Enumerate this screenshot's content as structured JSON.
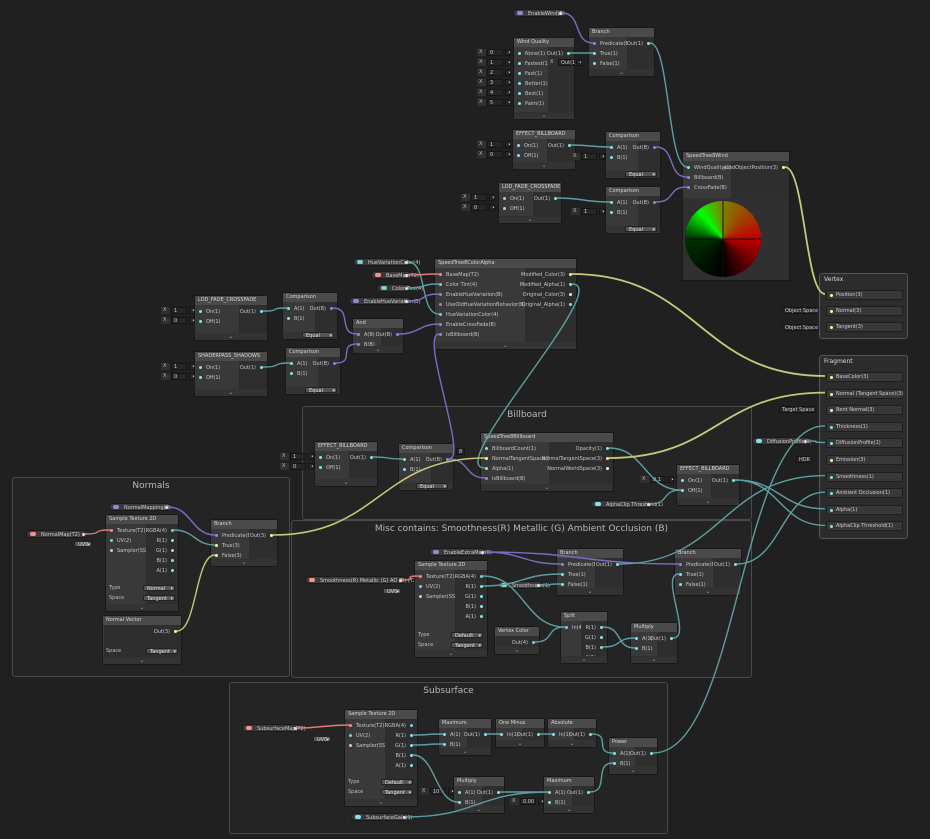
{
  "groups": {
    "billboard": "Billboard",
    "normals": "Normals",
    "misc": "Misc contains:  Smoothness(R) Metallic (G) Ambient Occlusion (B)",
    "subsurface": "Subsurface"
  },
  "nodes": {
    "branch_top": {
      "title": "Branch",
      "inputs": [
        "Predicate(B)",
        "True(1)",
        "False(1)"
      ],
      "outputs": [
        "Out(1)"
      ]
    },
    "wind_quality": {
      "title": "Wind Quality",
      "inputs": [
        "None(1)",
        "Fastest(1)",
        "Fast(1)",
        "Better(1)",
        "Best(1)",
        "Palm(1)"
      ],
      "outputs": [
        "Out(1)"
      ],
      "values": [
        "0",
        "1",
        "2",
        "3",
        "4",
        "5"
      ]
    },
    "effect_billboard_1": {
      "title": "EFFECT_BILLBOARD",
      "inputs": [
        "On(1)",
        "Off(1)"
      ],
      "outputs": [
        "Out(1)"
      ],
      "values": [
        "1",
        "0"
      ]
    },
    "comparison_1": {
      "title": "Comparison",
      "inputs": [
        "A(1)",
        "B(1)"
      ],
      "outputs": [
        "Out(B)"
      ],
      "select": "Equal",
      "b_value": "1"
    },
    "lod_fade_1": {
      "title": "LOD_FADE_CROSSFADE",
      "inputs": [
        "On(1)",
        "Off(1)"
      ],
      "outputs": [
        "Out(1)"
      ],
      "values": [
        "1",
        "0"
      ]
    },
    "comparison_2": {
      "title": "Comparison",
      "inputs": [
        "A(1)",
        "B(1)"
      ],
      "outputs": [
        "Out(B)"
      ],
      "select": "Equal",
      "b_value": "1"
    },
    "speedtree_wind": {
      "title": "SpeedTree8Wind",
      "inputs": [
        "WindQuality(1)",
        "Billboard(B)",
        "CrossFade(B)"
      ],
      "outputs": [
        "windObjectPosition(3)"
      ]
    },
    "color_alpha": {
      "title": "SpeedTree8ColorAlpha",
      "inputs": [
        "BaseMap(T2)",
        "Color Tint(4)",
        "EnableHueVariation(B)",
        "UseOldHueVariationBehavior(B)",
        "HueVariationColor(4)",
        "EnableCrossFade(B)",
        "IsBillboard(B)"
      ],
      "outputs": [
        "Modified_Color(3)",
        "Modified_Alpha(1)",
        "Original_Color(3)",
        "Original_Alpha(1)"
      ]
    },
    "lod_fade_2": {
      "title": "LOD_FADE_CROSSFADE",
      "inputs": [
        "On(1)",
        "Off(1)"
      ],
      "outputs": [
        "Out(1)"
      ],
      "values": [
        "1",
        "0"
      ]
    },
    "comparison_3": {
      "title": "Comparison",
      "inputs": [
        "A(1)",
        "B(1)"
      ],
      "outputs": [
        "Out(B)"
      ],
      "select": "Equal",
      "b_value": "1"
    },
    "shaderpass": {
      "title": "SHADERPASS_SHADOWS",
      "inputs": [
        "On(1)",
        "Off(1)"
      ],
      "outputs": [
        "Out(1)"
      ],
      "values": [
        "1",
        "0"
      ]
    },
    "comparison_4": {
      "title": "Comparison",
      "inputs": [
        "A(1)",
        "B(1)"
      ],
      "outputs": [
        "Out(B)"
      ],
      "select": "Equal",
      "b_value": "1"
    },
    "and": {
      "title": "And",
      "inputs": [
        "A(B)",
        "B(B)"
      ],
      "outputs": [
        "Out(B)"
      ]
    },
    "effect_billboard_2": {
      "title": "EFFECT_BILLBOARD",
      "inputs": [
        "On(1)",
        "Off(1)"
      ],
      "outputs": [
        "Out(1)"
      ],
      "values": [
        "1",
        "0"
      ]
    },
    "comparison_5": {
      "title": "Comparison",
      "inputs": [
        "A(1)",
        "B(1)"
      ],
      "outputs": [
        "Out(B)"
      ],
      "select": "Equal",
      "b_value": "1"
    },
    "speedtree_billboard": {
      "title": "SpeedTree8Billboard",
      "inputs": [
        "BillboardCount(1)",
        "NormalTangentSpace(3)",
        "Alpha(1)",
        "IsBillboard(B)"
      ],
      "outputs": [
        "Opacity(1)",
        "NormalTangentSpace(3)",
        "NormalWorldSpace(3)"
      ],
      "count_value": "8"
    },
    "effect_billboard_3": {
      "title": "EFFECT_BILLBOARD",
      "inputs": [
        "On(1)",
        "Off(1)"
      ],
      "outputs": [
        "Out(1)"
      ],
      "on_value": "0.1"
    },
    "sample_normal": {
      "title": "Sample Texture 2D",
      "inputs": [
        "Texture(T2)",
        "UV(2)",
        "Sampler(SS)"
      ],
      "outputs": [
        "RGBA(4)",
        "R(1)",
        "G(1)",
        "B(1)",
        "A(1)"
      ],
      "type_label": "Type",
      "type_value": "Normal",
      "space_label": "Space",
      "space_value": "Tangent",
      "uv_value": "UV0"
    },
    "branch_normal": {
      "title": "Branch",
      "inputs": [
        "Predicate(B)",
        "True(3)",
        "False(3)"
      ],
      "outputs": [
        "Out(3)"
      ]
    },
    "normal_vector": {
      "title": "Normal Vector",
      "outputs": [
        "Out(3)"
      ],
      "space_label": "Space",
      "space_value": "Tangent"
    },
    "sample_misc": {
      "title": "Sample Texture 2D",
      "inputs": [
        "Texture(T2)",
        "UV(2)",
        "Sampler(SS)"
      ],
      "outputs": [
        "RGBA(4)",
        "R(1)",
        "G(1)",
        "B(1)",
        "A(1)"
      ],
      "type_label": "Type",
      "type_value": "Default",
      "space_label": "Space",
      "space_value": "Tangent",
      "uv_value": "UV0"
    },
    "branch_misc_1": {
      "title": "Branch",
      "inputs": [
        "Predicate(B)",
        "True(1)",
        "False(1)"
      ],
      "outputs": [
        "Out(1)"
      ]
    },
    "branch_misc_2": {
      "title": "Branch",
      "inputs": [
        "Predicate(B)",
        "True(1)",
        "False(1)"
      ],
      "outputs": [
        "Out(1)"
      ]
    },
    "split": {
      "title": "Split",
      "inputs": [
        "In(4)"
      ],
      "outputs": [
        "R(1)",
        "G(1)",
        "B(1)",
        "A(1)"
      ]
    },
    "vertex_color": {
      "title": "Vertex Color",
      "outputs": [
        "Out(4)"
      ]
    },
    "multiply_1": {
      "title": "Multiply",
      "inputs": [
        "A(1)",
        "B(1)"
      ],
      "outputs": [
        "Out(1)"
      ]
    },
    "sample_sub": {
      "title": "Sample Texture 2D",
      "inputs": [
        "Texture(T2)",
        "UV(2)",
        "Sampler(SS)"
      ],
      "outputs": [
        "RGBA(4)",
        "R(1)",
        "G(1)",
        "B(1)",
        "A(1)"
      ],
      "type_label": "Type",
      "type_value": "Default",
      "space_label": "Space",
      "space_value": "Tangent",
      "uv_value": "UV0"
    },
    "maximum_1": {
      "title": "Maximum",
      "inputs": [
        "A(1)",
        "B(1)"
      ],
      "outputs": [
        "Out(1)"
      ]
    },
    "one_minus": {
      "title": "One Minus",
      "inputs": [
        "In(1)"
      ],
      "outputs": [
        "Out(1)"
      ]
    },
    "absolute": {
      "title": "Absolute",
      "inputs": [
        "In(1)"
      ],
      "outputs": [
        "Out(1)"
      ]
    },
    "power": {
      "title": "Power",
      "inputs": [
        "A(1)",
        "B(1)"
      ],
      "outputs": [
        "Out(1)"
      ]
    },
    "multiply_2": {
      "title": "Multiply",
      "inputs": [
        "A(1)",
        "B(1)"
      ],
      "outputs": [
        "Out(1)"
      ],
      "a_value": "10"
    },
    "maximum_2": {
      "title": "Maximum",
      "inputs": [
        "A(1)",
        "B(1)"
      ],
      "outputs": [
        "Out(1)"
      ],
      "b_value": "0.00"
    }
  },
  "properties": {
    "enable_wind": "EnableWind(B)",
    "hue_color": "HueVariationColor(4)",
    "base_map": "BaseMap(T2)",
    "color_tint": "Color Tint(4)",
    "enable_hue": "EnableHueVariation(B)",
    "normal_map_b": "NormalMapping(B)",
    "normal_map_t": "NormalMap(T2)",
    "enable_extras": "EnableExtraMap(B)",
    "misc_map": "Smoothness(R) Metallic (G) AO (B) (T2)",
    "smoothness": "Smoothness(1)",
    "subsurface_map": "SubsurfaceMap(T2)",
    "subsurface_gain": "SubsurfaceGain(1)",
    "alpha_clip": "AlphaClip Threshold(1)",
    "diffusion_profile": "DiffusionProfile(1)"
  },
  "master": {
    "vertex_title": "Vertex",
    "vertex_slots": [
      "Position(3)",
      "Normal(3)",
      "Tangent(3)"
    ],
    "fragment_title": "Fragment",
    "fragment_slots": [
      "BaseColor(3)",
      "Normal (Tangent Space)(3)",
      "Bent Normal(3)",
      "Thickness(1)",
      "DiffusionProfile(1)",
      "Emission(3)",
      "Smoothness(1)",
      "Ambient Occlusion(1)",
      "Alpha(1)",
      "AlphaClip Threshold(1)"
    ],
    "normal_space": "Object Space",
    "tangent_space": "Object Space",
    "bent_space": "Target Space",
    "hdr_label": "HDR"
  },
  "colors": {
    "wire_vector": "#5f9ea0",
    "wire_bool": "#7b6cc4",
    "wire_vec3": "#c8c878",
    "wire_tex": "#e07a7a",
    "accent": "#4d9ae0"
  }
}
